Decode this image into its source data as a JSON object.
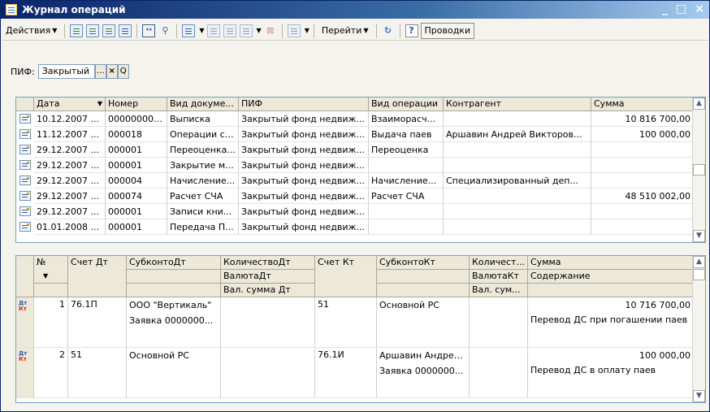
{
  "window": {
    "title": "Журнал операций",
    "controls": [
      "_",
      "□",
      "×"
    ]
  },
  "toolbar": {
    "actions_label": "Действия",
    "goto_label": "Перейти",
    "help_label": "?",
    "entries_label": "Проводки"
  },
  "filter": {
    "label": "ПИФ:",
    "value": "Закрытый",
    "select_btn": "...",
    "clear_btn": "×",
    "search_btn": "Q"
  },
  "journal": {
    "columns": [
      "Дата",
      "Номер",
      "Вид докуме...",
      "ПИФ",
      "Вид операции",
      "Контрагент",
      "Сумма"
    ],
    "rows": [
      [
        "10.12.2007 ...",
        "0000000027",
        "Выписка",
        "Закрытый фонд недвиж...",
        "Взаиморасч...",
        "",
        "10 816 700,00"
      ],
      [
        "11.12.2007 ...",
        "000018",
        "Операции с ...",
        "Закрытый фонд недвиж...",
        "Выдача паев",
        "Аршавин Андрей Викторов...",
        "100 000,00"
      ],
      [
        "29.12.2007 ...",
        "000001",
        "Переоценка...",
        "Закрытый фонд недвиж...",
        "Переоценка",
        "",
        ""
      ],
      [
        "29.12.2007 ...",
        "000001",
        "Закрытие м...",
        "Закрытый фонд недвиж...",
        "",
        "",
        ""
      ],
      [
        "29.12.2007 ...",
        "000004",
        "Начисление...",
        "Закрытый фонд недвиж...",
        "Начисление...",
        "Специализированный деп...",
        ""
      ],
      [
        "29.12.2007 ...",
        "000074",
        "Расчет СЧА",
        "Закрытый фонд недвиж...",
        "Расчет СЧА",
        "",
        "48 510 002,00"
      ],
      [
        "29.12.2007 ...",
        "000001",
        "Записи кни...",
        "Закрытый фонд недвиж...",
        "",
        "",
        ""
      ],
      [
        "01.01.2008 ...",
        "000001",
        "Передача П...",
        "Закрытый фонд недвиж...",
        "",
        "",
        ""
      ]
    ]
  },
  "entries": {
    "header1": [
      "№",
      "Счет Дт",
      "СубконтоДт",
      "КоличествоДт",
      "Счет Кт",
      "СубконтоКт",
      "Количест...",
      "Сумма"
    ],
    "header2": [
      "ВалютаДт",
      "ВалютаКт",
      "Содержание"
    ],
    "header3": [
      "Вал. сумма Дт",
      "Вал. сум..."
    ],
    "dt": "Дт",
    "kt": "Кт",
    "rows": [
      {
        "n": "1",
        "acc_dt": "76.1П",
        "sub_dt1": "ООО \"Вертикаль\"",
        "sub_dt2": "Заявка 0000000...",
        "acc_kt": "51",
        "sub_kt1": "Основной РС",
        "sub_kt2": "",
        "sum": "10 716 700,00",
        "content": "Перевод ДС при погашении паев"
      },
      {
        "n": "2",
        "acc_dt": "51",
        "sub_dt1": "Основной РС",
        "sub_dt2": "",
        "acc_kt": "76.1И",
        "sub_kt1": "Аршавин Андрей...",
        "sub_kt2": "Заявка 0000000...",
        "sum": "100 000,00",
        "content": "Перевод ДС в оплату паев"
      }
    ]
  }
}
